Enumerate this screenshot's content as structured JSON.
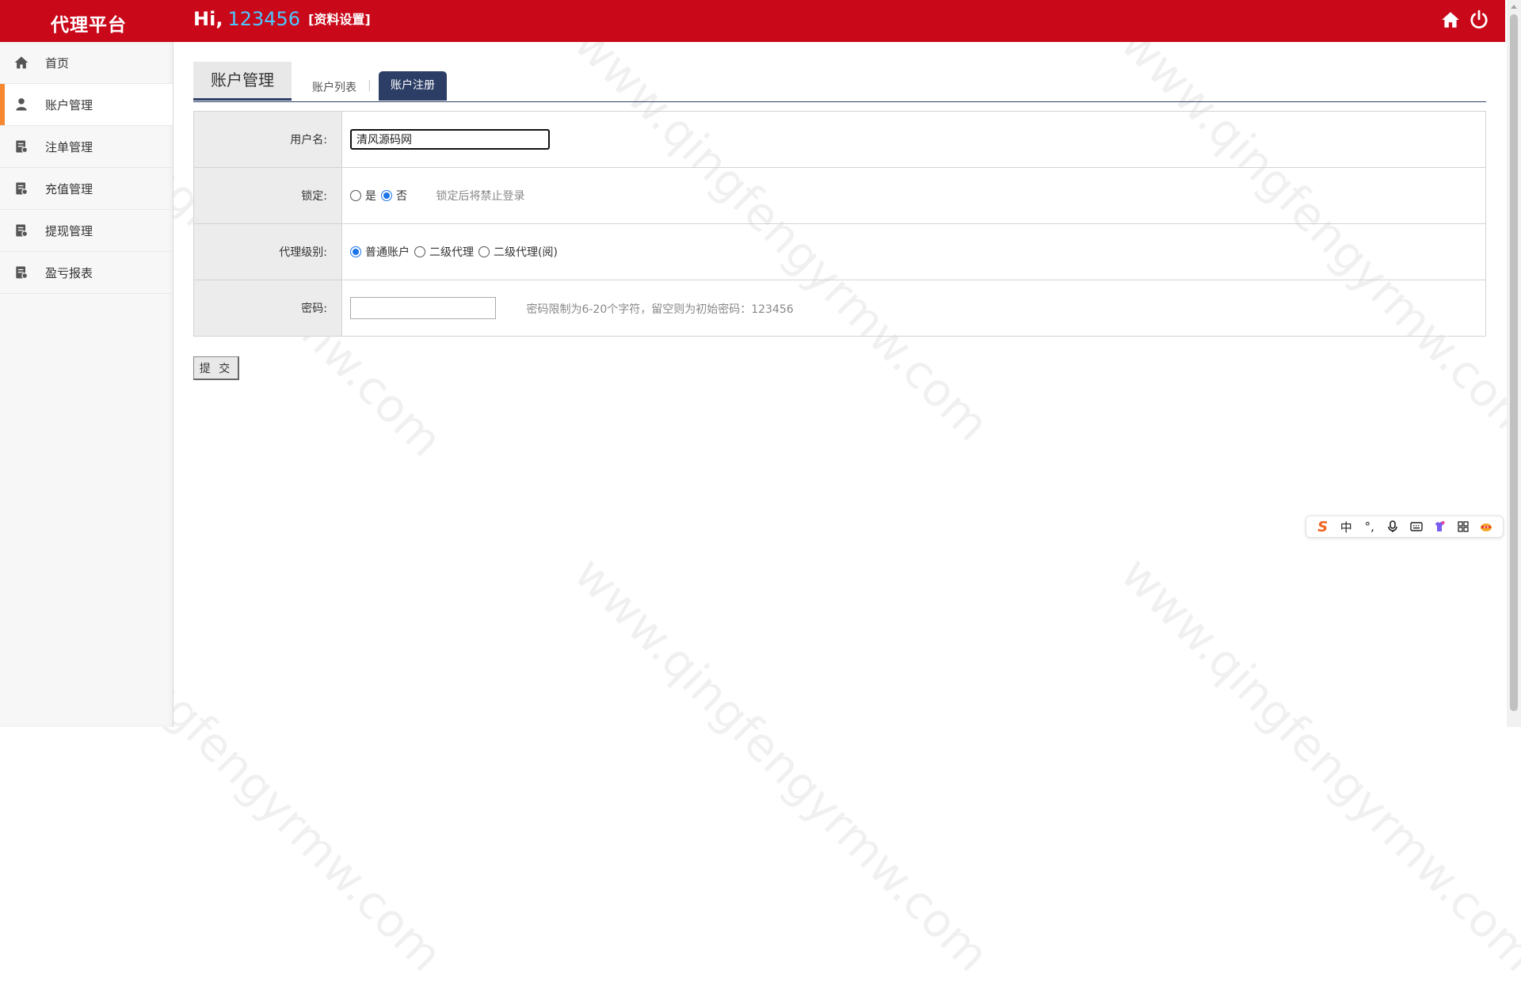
{
  "header": {
    "brand": "代理平台",
    "greeting": "Hi,",
    "username": "123456",
    "profile_link": "[资料设置]",
    "home_icon": "home-icon",
    "power_icon": "power-icon"
  },
  "sidebar": {
    "items": [
      {
        "label": "首页",
        "icon": "home-icon"
      },
      {
        "label": "账户管理",
        "icon": "user-icon"
      },
      {
        "label": "注单管理",
        "icon": "document-icon"
      },
      {
        "label": "充值管理",
        "icon": "document-icon"
      },
      {
        "label": "提现管理",
        "icon": "document-icon"
      },
      {
        "label": "盈亏报表",
        "icon": "document-icon"
      }
    ],
    "active_index": 1
  },
  "main": {
    "section_title": "账户管理",
    "tabs": [
      {
        "label": "账户列表",
        "active": false
      },
      {
        "label": "账户注册",
        "active": true
      }
    ],
    "tab_separator": "|"
  },
  "form": {
    "username": {
      "label": "用户名:",
      "value": "清风源码网"
    },
    "locked": {
      "label": "锁定:",
      "options": [
        "是",
        "否"
      ],
      "selected": "否",
      "hint": "锁定后将禁止登录"
    },
    "agent_level": {
      "label": "代理级别:",
      "options": [
        "普通账户",
        "二级代理",
        "二级代理(阅)"
      ],
      "selected": "普通账户"
    },
    "password": {
      "label": "密码:",
      "value": "",
      "hint": "密码限制为6-20个字符，留空则为初始密码：123456"
    },
    "submit_label": "提 交"
  },
  "ime_toolbar": {
    "logo": "S",
    "mode": "中",
    "punct": "°,"
  },
  "colors": {
    "header_bg": "#c9081a",
    "accent_navy": "#2c3e66",
    "active_indicator": "#f7882f",
    "username_color": "#4cc8ff",
    "radio_checked": "#1a73e8"
  }
}
